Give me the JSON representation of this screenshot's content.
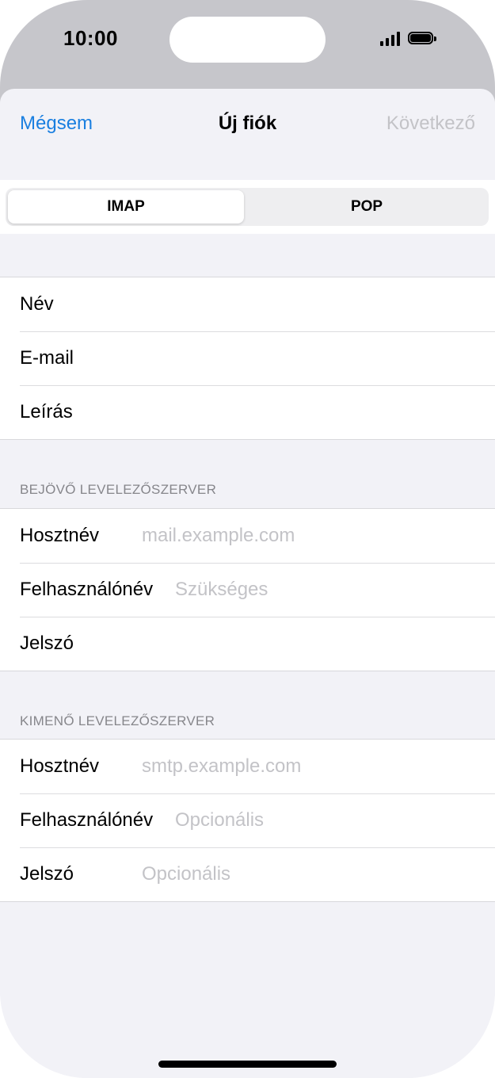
{
  "status_bar": {
    "time": "10:00"
  },
  "nav": {
    "cancel_label": "Mégsem",
    "title": "Új fiók",
    "next_label": "Következő"
  },
  "segment": {
    "options": [
      "IMAP",
      "POP"
    ],
    "selected": "IMAP"
  },
  "account": {
    "name_label": "Név",
    "email_label": "E-mail",
    "description_label": "Leírás"
  },
  "incoming": {
    "header": "BEJÖVŐ LEVELEZŐSZERVER",
    "hostname_label": "Hosztnév",
    "hostname_placeholder": "mail.example.com",
    "username_label": "Felhasználónév",
    "username_placeholder": "Szükséges",
    "password_label": "Jelszó"
  },
  "outgoing": {
    "header": "KIMENŐ LEVELEZŐSZERVER",
    "hostname_label": "Hosztnév",
    "hostname_placeholder": "smtp.example.com",
    "username_label": "Felhasználónév",
    "username_placeholder": "Opcionális",
    "password_label": "Jelszó",
    "password_placeholder": "Opcionális"
  },
  "colors": {
    "accent": "#1a7fe0",
    "disabled": "#c3c3c7",
    "grouped_background": "#f2f2f7"
  }
}
